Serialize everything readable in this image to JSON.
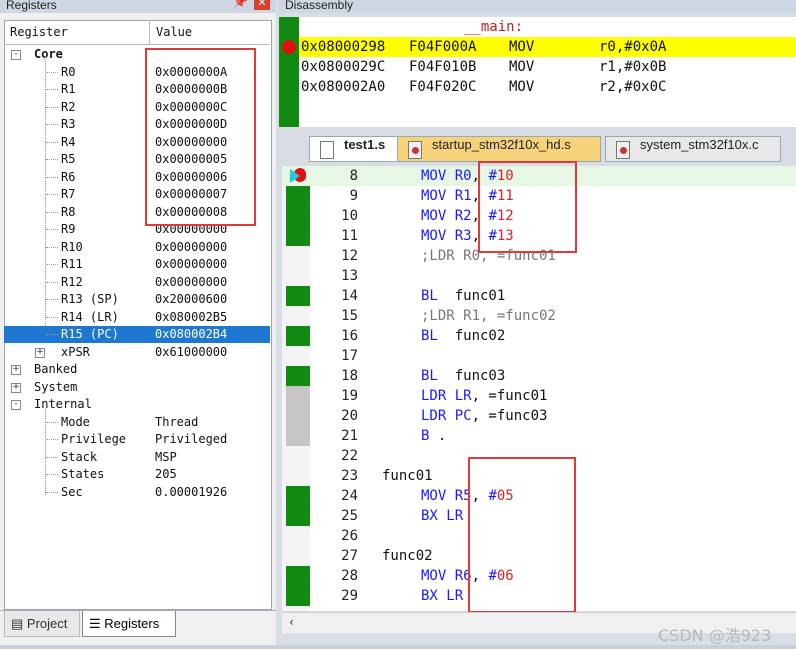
{
  "registers_panel": {
    "title": "Registers",
    "header_register": "Register",
    "header_value": "Value",
    "core_group": "Core",
    "core": [
      {
        "name": "R0",
        "value": "0x0000000A"
      },
      {
        "name": "R1",
        "value": "0x0000000B"
      },
      {
        "name": "R2",
        "value": "0x0000000C"
      },
      {
        "name": "R3",
        "value": "0x0000000D"
      },
      {
        "name": "R4",
        "value": "0x00000000"
      },
      {
        "name": "R5",
        "value": "0x00000005"
      },
      {
        "name": "R6",
        "value": "0x00000006"
      },
      {
        "name": "R7",
        "value": "0x00000007"
      },
      {
        "name": "R8",
        "value": "0x00000008"
      },
      {
        "name": "R9",
        "value": "0x00000000"
      },
      {
        "name": "R10",
        "value": "0x00000000"
      },
      {
        "name": "R11",
        "value": "0x00000000"
      },
      {
        "name": "R12",
        "value": "0x00000000"
      },
      {
        "name": "R13 (SP)",
        "value": "0x20000600"
      },
      {
        "name": "R14 (LR)",
        "value": "0x080002B5"
      },
      {
        "name": "R15 (PC)",
        "value": "0x080002B4"
      },
      {
        "name": "xPSR",
        "value": "0x61000000"
      }
    ],
    "groups": [
      "Banked",
      "System",
      "Internal"
    ],
    "internal": [
      {
        "name": "Mode",
        "value": "Thread"
      },
      {
        "name": "Privilege",
        "value": "Privileged"
      },
      {
        "name": "Stack",
        "value": "MSP"
      },
      {
        "name": "States",
        "value": "205"
      },
      {
        "name": "Sec",
        "value": "0.00001926"
      }
    ],
    "tabs": {
      "project": "Project",
      "registers": "Registers"
    }
  },
  "disassembly": {
    "title": "Disassembly",
    "label": "__main:",
    "lines": [
      {
        "addr": "0x08000298",
        "hex": "F04F000A",
        "op": "MOV",
        "args": "r0,#0x0A"
      },
      {
        "addr": "0x0800029C",
        "hex": "F04F010B",
        "op": "MOV",
        "args": "r1,#0x0B"
      },
      {
        "addr": "0x080002A0",
        "hex": "F04F020C",
        "op": "MOV",
        "args": "r2,#0x0C"
      }
    ]
  },
  "editor": {
    "tabs": [
      "test1.s",
      "startup_stm32f10x_hd.s",
      "system_stm32f10x.c"
    ],
    "lines": [
      {
        "n": "8",
        "ind": true,
        "parts": [
          {
            "t": "MOV ",
            "c": "kw"
          },
          {
            "t": "R0",
            "c": "kw"
          },
          {
            "t": ", ",
            "c": ""
          },
          {
            "t": "#",
            "c": "kw"
          },
          {
            "t": "10",
            "c": "num"
          }
        ]
      },
      {
        "n": "9",
        "ind": true,
        "parts": [
          {
            "t": "MOV ",
            "c": "kw"
          },
          {
            "t": "R1",
            "c": "kw"
          },
          {
            "t": ", ",
            "c": ""
          },
          {
            "t": "#",
            "c": "kw"
          },
          {
            "t": "11",
            "c": "num"
          }
        ]
      },
      {
        "n": "10",
        "ind": true,
        "parts": [
          {
            "t": "MOV ",
            "c": "kw"
          },
          {
            "t": "R2",
            "c": "kw"
          },
          {
            "t": ", ",
            "c": ""
          },
          {
            "t": "#",
            "c": "kw"
          },
          {
            "t": "12",
            "c": "num"
          }
        ]
      },
      {
        "n": "11",
        "ind": true,
        "parts": [
          {
            "t": "MOV ",
            "c": "kw"
          },
          {
            "t": "R3",
            "c": "kw"
          },
          {
            "t": ", ",
            "c": ""
          },
          {
            "t": "#",
            "c": "kw"
          },
          {
            "t": "13",
            "c": "num"
          }
        ]
      },
      {
        "n": "12",
        "ind": true,
        "parts": [
          {
            "t": ";LDR R0, =func01",
            "c": "cm"
          }
        ]
      },
      {
        "n": "13",
        "ind": false,
        "parts": []
      },
      {
        "n": "14",
        "ind": true,
        "parts": [
          {
            "t": "BL  ",
            "c": "kw"
          },
          {
            "t": "func01",
            "c": ""
          }
        ]
      },
      {
        "n": "15",
        "ind": true,
        "parts": [
          {
            "t": ";LDR R1, =func02",
            "c": "cm"
          }
        ]
      },
      {
        "n": "16",
        "ind": true,
        "parts": [
          {
            "t": "BL  ",
            "c": "kw"
          },
          {
            "t": "func02",
            "c": ""
          }
        ]
      },
      {
        "n": "17",
        "ind": false,
        "parts": []
      },
      {
        "n": "18",
        "ind": true,
        "parts": [
          {
            "t": "BL  ",
            "c": "kw"
          },
          {
            "t": "func03",
            "c": ""
          }
        ]
      },
      {
        "n": "19",
        "ind": true,
        "parts": [
          {
            "t": "LDR ",
            "c": "kw"
          },
          {
            "t": "LR",
            "c": "kw"
          },
          {
            "t": ", =func01",
            "c": ""
          }
        ]
      },
      {
        "n": "20",
        "ind": true,
        "parts": [
          {
            "t": "LDR ",
            "c": "kw"
          },
          {
            "t": "PC",
            "c": "kw"
          },
          {
            "t": ", =func03",
            "c": ""
          }
        ]
      },
      {
        "n": "21",
        "ind": true,
        "parts": [
          {
            "t": "B ",
            "c": "kw"
          },
          {
            "t": ".",
            "c": ""
          }
        ]
      },
      {
        "n": "22",
        "ind": false,
        "parts": []
      },
      {
        "n": "23",
        "ind": false,
        "parts": [
          {
            "t": "func01",
            "c": ""
          }
        ]
      },
      {
        "n": "24",
        "ind": true,
        "parts": [
          {
            "t": "MOV ",
            "c": "kw"
          },
          {
            "t": "R5",
            "c": "kw"
          },
          {
            "t": ", ",
            "c": ""
          },
          {
            "t": "#",
            "c": "kw"
          },
          {
            "t": "05",
            "c": "num"
          }
        ]
      },
      {
        "n": "25",
        "ind": true,
        "parts": [
          {
            "t": "BX ",
            "c": "kw"
          },
          {
            "t": "LR",
            "c": "kw"
          }
        ]
      },
      {
        "n": "26",
        "ind": false,
        "parts": []
      },
      {
        "n": "27",
        "ind": false,
        "parts": [
          {
            "t": "func02",
            "c": ""
          }
        ]
      },
      {
        "n": "28",
        "ind": true,
        "parts": [
          {
            "t": "MOV ",
            "c": "kw"
          },
          {
            "t": "R6",
            "c": "kw"
          },
          {
            "t": ", ",
            "c": ""
          },
          {
            "t": "#",
            "c": "kw"
          },
          {
            "t": "06",
            "c": "num"
          }
        ]
      },
      {
        "n": "29",
        "ind": true,
        "parts": [
          {
            "t": "BX ",
            "c": "kw"
          },
          {
            "t": "LR",
            "c": "kw"
          }
        ]
      }
    ],
    "margin": [
      "g",
      "g",
      "g",
      "g",
      "",
      "",
      "g",
      "",
      "g",
      "",
      "g",
      "gr",
      "gr",
      "gr",
      "",
      "",
      "g",
      "g",
      "",
      "",
      "g",
      "g"
    ]
  },
  "watermark": "CSDN @浩923",
  "colors": {
    "accent": "#1e78d2",
    "exec_green": "#118a11",
    "current_line": "#ffff00",
    "annotation_red": "#e03a3a"
  }
}
